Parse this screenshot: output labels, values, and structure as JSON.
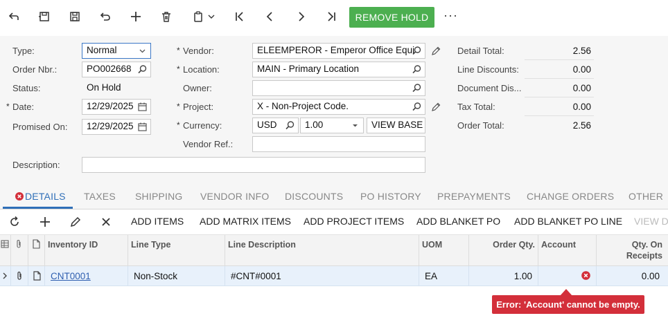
{
  "toolbar": {
    "remove_hold": "REMOVE HOLD",
    "ellipsis": "···"
  },
  "form": {
    "type": {
      "label": "Type:",
      "value": "Normal"
    },
    "order_nbr": {
      "label": "Order Nbr.:",
      "value": "PO002668"
    },
    "status": {
      "label": "Status:",
      "value": "On Hold"
    },
    "date": {
      "label": "Date:",
      "value": "12/29/2025"
    },
    "promised_on": {
      "label": "Promised On:",
      "value": "12/29/2025"
    },
    "description": {
      "label": "Description:",
      "value": ""
    },
    "vendor": {
      "label": "Vendor:",
      "value": "ELEEMPEROR - Emperor Office Equi"
    },
    "location": {
      "label": "Location:",
      "value": "MAIN - Primary Location"
    },
    "owner": {
      "label": "Owner:",
      "value": ""
    },
    "project": {
      "label": "Project:",
      "value": "X - Non-Project Code."
    },
    "currency": {
      "label": "Currency:",
      "code": "USD",
      "rate": "1.00",
      "view_base": "VIEW BASE"
    },
    "vendor_ref": {
      "label": "Vendor Ref.:",
      "value": ""
    }
  },
  "totals": {
    "detail_total": {
      "label": "Detail Total:",
      "value": "2.56"
    },
    "line_discounts": {
      "label": "Line Discounts:",
      "value": "0.00"
    },
    "document_discount": {
      "label": "Document Dis...",
      "value": "0.00"
    },
    "tax_total": {
      "label": "Tax Total:",
      "value": "0.00"
    },
    "order_total": {
      "label": "Order Total:",
      "value": "2.56"
    }
  },
  "tabs": [
    {
      "label": "DETAILS"
    },
    {
      "label": "TAXES"
    },
    {
      "label": "SHIPPING"
    },
    {
      "label": "VENDOR INFO"
    },
    {
      "label": "DISCOUNTS"
    },
    {
      "label": "PO HISTORY"
    },
    {
      "label": "PREPAYMENTS"
    },
    {
      "label": "CHANGE ORDERS"
    },
    {
      "label": "OTHER"
    }
  ],
  "grid_toolbar": {
    "add_items": "ADD ITEMS",
    "add_matrix_items": "ADD MATRIX ITEMS",
    "add_project_items": "ADD PROJECT ITEMS",
    "add_blanket_po": "ADD BLANKET PO",
    "add_blanket_po_line": "ADD BLANKET PO LINE",
    "view_de": "VIEW DE"
  },
  "grid": {
    "columns": {
      "inventory_id": "Inventory ID",
      "line_type": "Line Type",
      "line_description": "Line Description",
      "uom": "UOM",
      "order_qty": "Order Qty.",
      "account": "Account",
      "qty_on_receipts_1": "Qty. On",
      "qty_on_receipts_2": "Receipts"
    },
    "rows": [
      {
        "inventory_id": "CNT0001",
        "line_type": "Non-Stock",
        "line_description": "#CNT#0001",
        "uom": "EA",
        "order_qty": "1.00",
        "account": "",
        "qty_on_receipts": "0.00"
      }
    ]
  },
  "error": {
    "message": "Error: 'Account' cannot be empty."
  },
  "colors": {
    "accent": "#2f6fb8",
    "success": "#4caf50",
    "error": "#d32f3a",
    "row_selected": "#e8f1fb"
  }
}
